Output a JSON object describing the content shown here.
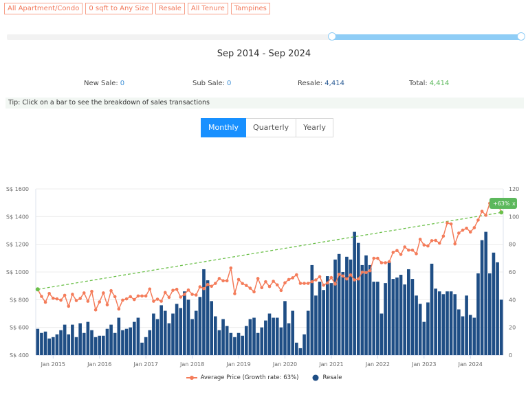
{
  "filters": [
    "All Apartment/Condo",
    "0 sqft to Any Size",
    "Resale",
    "All Tenure",
    "Tampines"
  ],
  "period_label": "Sep 2014 - Sep 2024",
  "slider": {
    "selected_start_fraction": 0.632,
    "selected_end_fraction": 1.0
  },
  "stats": [
    {
      "label": "New Sale:",
      "value": "0",
      "color": "#3d8fd6"
    },
    {
      "label": "Sub Sale:",
      "value": "0",
      "color": "#3d8fd6"
    },
    {
      "label": "Resale:",
      "value": "4,414",
      "color": "#2d5d96"
    },
    {
      "label": "Total:",
      "value": "4,414",
      "color": "#5cb85c"
    }
  ],
  "tip": "Tip: Click on a bar to see the breakdown of sales transactions",
  "view_buttons": [
    {
      "label": "Monthly",
      "active": true
    },
    {
      "label": "Quarterly",
      "active": false
    },
    {
      "label": "Yearly",
      "active": false
    }
  ],
  "chart_data": {
    "type": "bar+line",
    "x_start": "Sep 2014",
    "x_end": "Sep 2024",
    "x_tick_labels": [
      "Jan 2015",
      "Jan 2016",
      "Jan 2017",
      "Jan 2018",
      "Jan 2019",
      "Jan 2020",
      "Jan 2021",
      "Jan 2022",
      "Jan 2023",
      "Jan 2024"
    ],
    "left_axis": {
      "range": [
        400,
        1600
      ],
      "tick_labels": [
        "S$ 400",
        "S$ 600",
        "S$ 800",
        "S$ 1000",
        "S$ 1200",
        "S$ 1400",
        "S$ 1600"
      ]
    },
    "right_axis": {
      "range": [
        0,
        120
      ],
      "tick_labels": [
        "0",
        "20",
        "40",
        "60",
        "80",
        "100",
        "120"
      ]
    },
    "grid": true,
    "legend_position": "bottom",
    "series": [
      {
        "name": "Average Price (Growth rate: 63%)",
        "type": "line",
        "axis": "left",
        "color": "#f47c5a",
        "values": [
          875,
          824,
          782,
          845,
          811,
          806,
          797,
          832,
          753,
          839,
          794,
          809,
          849,
          789,
          860,
          726,
          784,
          849,
          763,
          865,
          822,
          733,
          797,
          806,
          822,
          801,
          827,
          827,
          827,
          877,
          789,
          804,
          789,
          852,
          817,
          868,
          875,
          819,
          839,
          870,
          839,
          834,
          893,
          880,
          910,
          897,
          918,
          953,
          937,
          937,
          1029,
          844,
          946,
          917,
          903,
          883,
          857,
          953,
          887,
          930,
          895,
          933,
          907,
          867,
          922,
          946,
          958,
          980,
          918,
          918,
          918,
          930,
          943,
          966,
          905,
          921,
          960,
          913,
          983,
          971,
          950,
          979,
          943,
          950,
          999,
          996,
          1009,
          1099,
          1099,
          1067,
          1067,
          1075,
          1142,
          1155,
          1127,
          1181,
          1158,
          1158,
          1132,
          1236,
          1195,
          1188,
          1226,
          1228,
          1208,
          1259,
          1354,
          1347,
          1203,
          1281,
          1302,
          1316,
          1289,
          1320,
          1375,
          1438,
          1410,
          1496,
          1505,
          1500,
          1430
        ]
      },
      {
        "name": "Resale",
        "type": "bar",
        "axis": "right",
        "color": "#1f4e85",
        "values": [
          19,
          16,
          17,
          12,
          13,
          15,
          18,
          22,
          15,
          22,
          13,
          23,
          16,
          24,
          18,
          13,
          14,
          14,
          19,
          22,
          16,
          27,
          18,
          19,
          20,
          24,
          27,
          9,
          13,
          18,
          30,
          26,
          36,
          32,
          23,
          30,
          37,
          34,
          46,
          40,
          26,
          32,
          42,
          62,
          54,
          39,
          28,
          18,
          26,
          21,
          16,
          13,
          16,
          14,
          21,
          26,
          27,
          16,
          20,
          25,
          30,
          27,
          27,
          20,
          39,
          23,
          32,
          9,
          5,
          15,
          32,
          65,
          43,
          53,
          47,
          57,
          52,
          69,
          73,
          60,
          71,
          69,
          89,
          81,
          65,
          72,
          65,
          53,
          53,
          30,
          52,
          67,
          55,
          56,
          58,
          51,
          62,
          55,
          43,
          37,
          24,
          38,
          66,
          48,
          46,
          44,
          46,
          46,
          44,
          33,
          28,
          43,
          29,
          27,
          59,
          83,
          89,
          59,
          74,
          67,
          40
        ]
      }
    ],
    "trend_line": {
      "from": 875,
      "to": 1430,
      "color": "#6cc04a",
      "label": "+63%",
      "close": "x"
    }
  }
}
